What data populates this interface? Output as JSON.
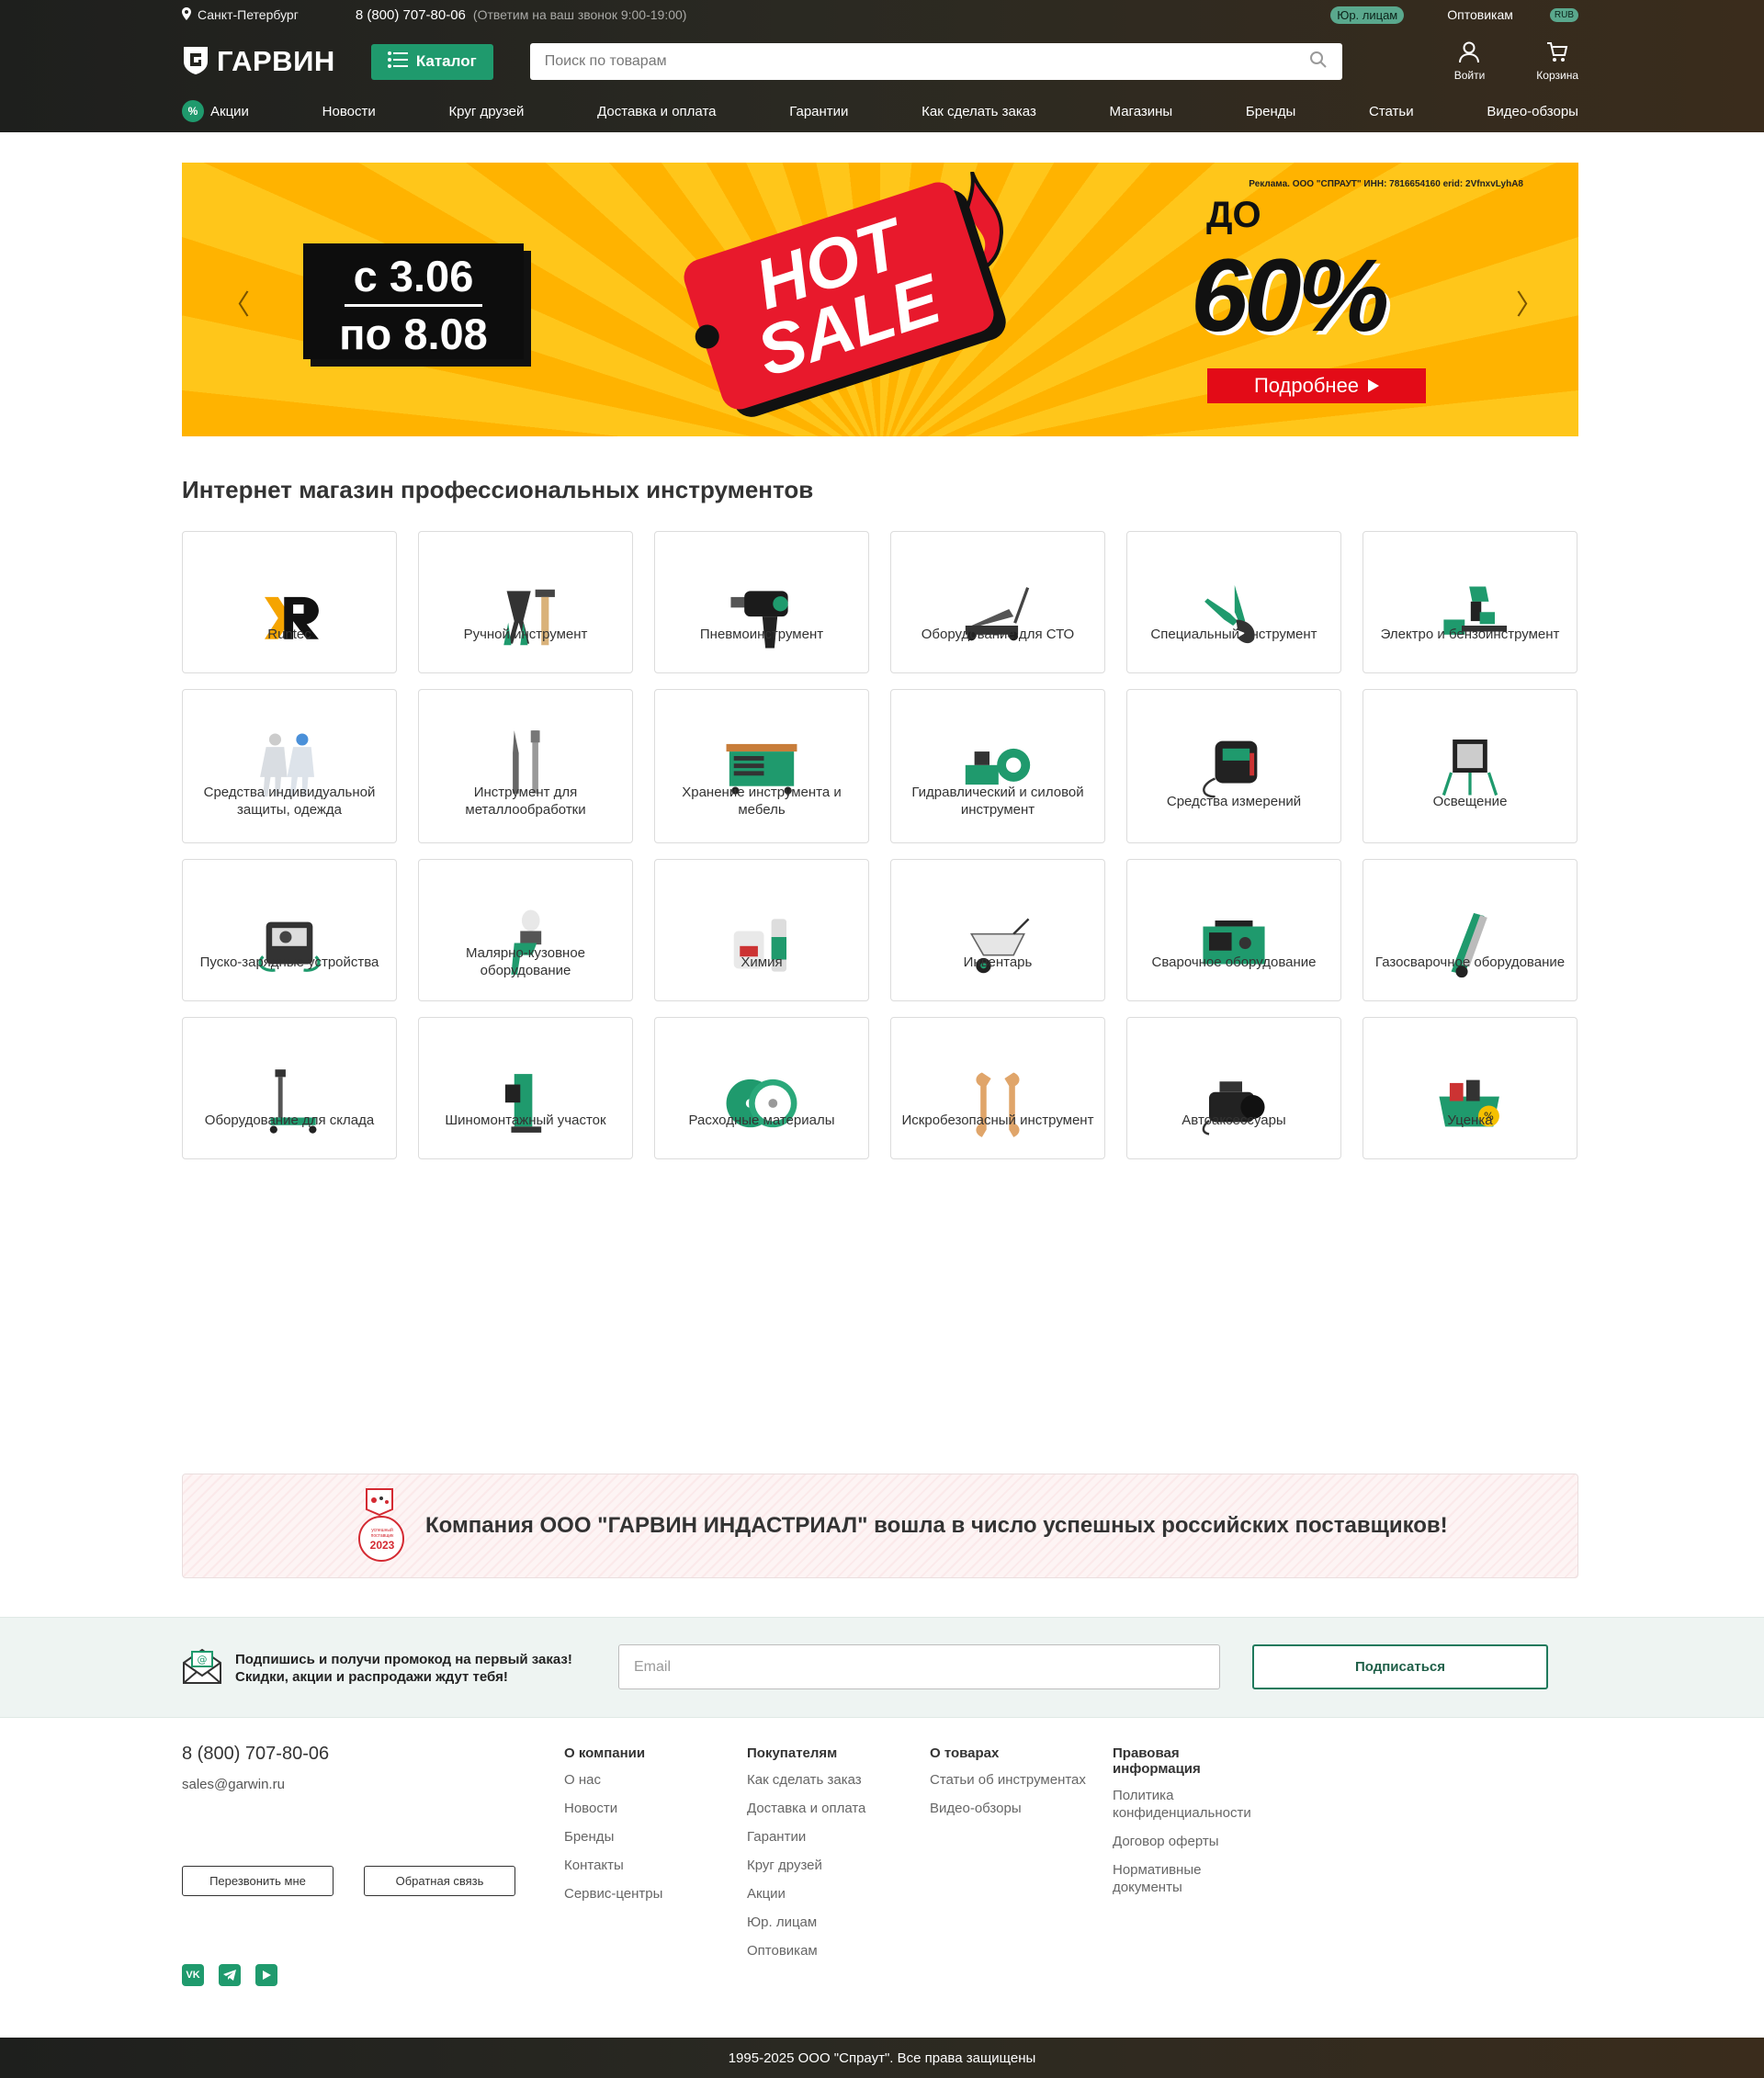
{
  "header": {
    "city": "Санкт-Петербург",
    "phone": "8 (800) 707-80-06",
    "phone_note": "(Ответим на ваш звонок 9:00-19:00)",
    "legal_entities": "Юр. лицам",
    "wholesale": "Оптовикам",
    "currency": "RUB",
    "logo": "ГАРВИН",
    "catalog": "Каталог",
    "search_placeholder": "Поиск по товарам",
    "login": "Войти",
    "cart": "Корзина",
    "nav": [
      "Акции",
      "Новости",
      "Круг друзей",
      "Доставка и оплата",
      "Гарантии",
      "Как сделать заказ",
      "Магазины",
      "Бренды",
      "Статьи",
      "Видео-обзоры"
    ]
  },
  "banner": {
    "ad_note": "Реклама. ООО \"СПРАУТ\" ИНН: 7816654160 erid: 2VfnxvLyhA8",
    "date_from": "с 3.06",
    "date_to": "по 8.08",
    "hot": "HOT",
    "sale": "SALE",
    "up_to": "ДО",
    "discount": "60%",
    "more": "Подробнее"
  },
  "main": {
    "title": "Интернет магазин профессиональных инструментов",
    "categories": [
      "Runtec",
      "Ручной инструмент",
      "Пневмоинструмент",
      "Оборудование для СТО",
      "Специальный инструмент",
      "Электро и бензоинструмент",
      "Средства индивидуальной защиты, одежда",
      "Инструмент для металлообработки",
      "Хранение инструмента и мебель",
      "Гидравлический и силовой инструмент",
      "Средства измерений",
      "Освещение",
      "Пуско-зарядные устройства",
      "Малярно-кузовное оборудование",
      "Химия",
      "Инвентарь",
      "Сварочное оборудование",
      "Газосварочное оборудование",
      "Оборудование для склада",
      "Шиномонтажный участок",
      "Расходные материалы",
      "Искробезопасный инструмент",
      "Автоаксессуары",
      "Уценка"
    ]
  },
  "award": {
    "badge_text": "успешный поставщик",
    "badge_year": "2023",
    "text": "Компания ООО \"ГАРВИН ИНДАСТРИАЛ\" вошла в число успешных российских поставщиков!"
  },
  "subscribe": {
    "line1": "Подпишись и получи промокод на первый заказ!",
    "line2": "Скидки, акции и распродажи ждут тебя!",
    "email_placeholder": "Email",
    "button": "Подписаться"
  },
  "footer": {
    "phone": "8 (800) 707-80-06",
    "email": "sales@garwin.ru",
    "callback": "Перезвонить мне",
    "feedback": "Обратная связь",
    "socials": [
      "VK",
      "TG",
      "YT"
    ],
    "columns": [
      {
        "title": "О компании",
        "links": [
          "О нас",
          "Новости",
          "Бренды",
          "Контакты",
          "Сервис-центры"
        ]
      },
      {
        "title": "Покупателям",
        "links": [
          "Как сделать заказ",
          "Доставка и оплата",
          "Гарантии",
          "Круг друзей",
          "Акции",
          "Юр. лицам",
          "Оптовикам"
        ]
      },
      {
        "title": "О товарах",
        "links": [
          "Статьи об инструментах",
          "Видео-обзоры"
        ]
      },
      {
        "title": "Правовая информация",
        "links": [
          "Политика конфиденциальности",
          "Договор оферты",
          "Нормативные документы"
        ]
      }
    ],
    "copyright": "1995-2025 ООО \"Спраут\". Все права защищены"
  },
  "colors": {
    "accent": "#1f9a6d",
    "header_bg": "#24241f",
    "banner_yellow": "#ffc61a",
    "sale_red": "#e8192c"
  }
}
